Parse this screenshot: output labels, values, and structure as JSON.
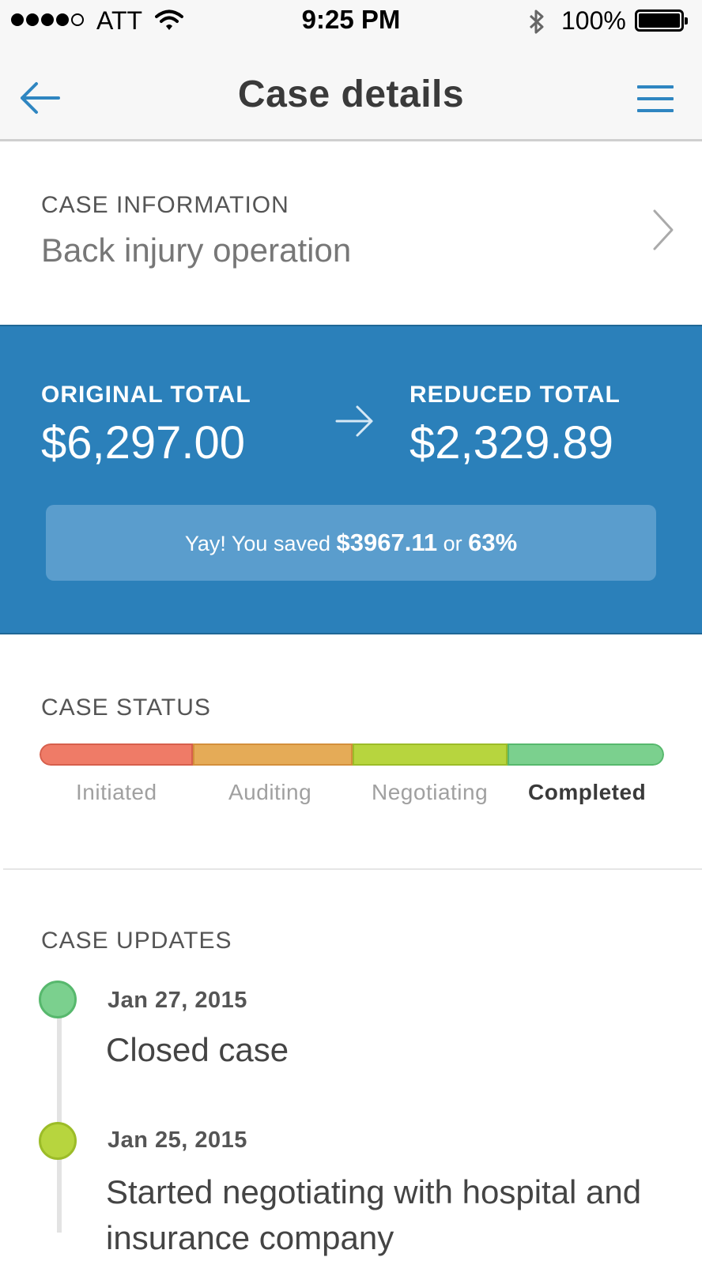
{
  "status_bar": {
    "carrier": "ATT",
    "time": "9:25 PM",
    "battery": "100%",
    "icons": [
      "signal-dots-icon",
      "wifi-icon",
      "bluetooth-icon",
      "battery-icon"
    ]
  },
  "navbar": {
    "title": "Case details",
    "back_icon": "arrow-left-icon",
    "menu_icon": "hamburger-menu-icon",
    "accent_color": "#2f86c1"
  },
  "case_information": {
    "label": "CASE INFORMATION",
    "value": "Back injury operation"
  },
  "totals": {
    "background_color": "#2b80ba",
    "original_label": "ORIGINAL TOTAL",
    "original_value": "$6,297.00",
    "reduced_label": "REDUCED TOTAL",
    "reduced_value": "$2,329.89",
    "savings": {
      "prefix": "Yay! You saved ",
      "amount": "$3967.11",
      "connector": " or ",
      "percent": "63%"
    }
  },
  "case_status": {
    "label": "CASE STATUS",
    "stages": [
      {
        "label": "Initiated",
        "color": "#ef7b67",
        "active": false
      },
      {
        "label": "Auditing",
        "color": "#e5ab57",
        "active": false
      },
      {
        "label": "Negotiating",
        "color": "#b7d53e",
        "active": false
      },
      {
        "label": "Completed",
        "color": "#7bd08e",
        "active": true
      }
    ]
  },
  "case_updates": {
    "label": "CASE UPDATES",
    "items": [
      {
        "date": "Jan 27, 2015",
        "text": "Closed case",
        "dot_color": "#7bd08e"
      },
      {
        "date": "Jan 25, 2015",
        "text": "Started negotiating with hospital and insurance company",
        "dot_color": "#b7d53e"
      }
    ]
  }
}
